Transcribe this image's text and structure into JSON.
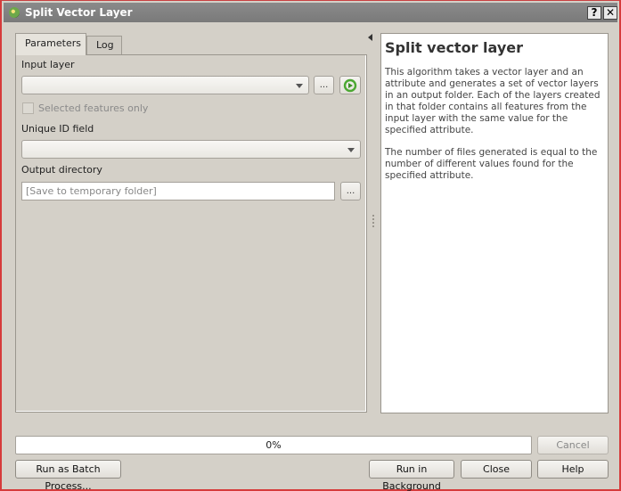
{
  "window": {
    "title": "Split Vector Layer",
    "help_button": "?",
    "close_button": "✕"
  },
  "tabs": [
    {
      "label": "Parameters",
      "active": true
    },
    {
      "label": "Log",
      "active": false
    }
  ],
  "parameters": {
    "input_layer": {
      "label": "Input layer",
      "value": "",
      "browse_label": "...",
      "iterate_icon": "iterate-icon"
    },
    "selected_features_only": {
      "label": "Selected features only",
      "checked": false,
      "enabled": false
    },
    "unique_id_field": {
      "label": "Unique ID field",
      "value": ""
    },
    "output_directory": {
      "label": "Output directory",
      "placeholder": "[Save to temporary folder]",
      "value": "",
      "browse_label": "..."
    }
  },
  "help": {
    "title": "Split vector layer",
    "paragraphs": [
      "This algorithm takes a vector layer and an attribute and generates a set of vector layers in an output folder. Each of the layers created in that folder contains all features from the input layer with the same value for the specified attribute.",
      "The number of files generated is equal to the number of different values found for the specified attribute."
    ]
  },
  "progress": {
    "value_percent": 0,
    "text": "0%"
  },
  "buttons": {
    "cancel": "Cancel",
    "run_batch": "Run as Batch Process...",
    "run_background": "Run in Background",
    "close": "Close",
    "help": "Help"
  }
}
